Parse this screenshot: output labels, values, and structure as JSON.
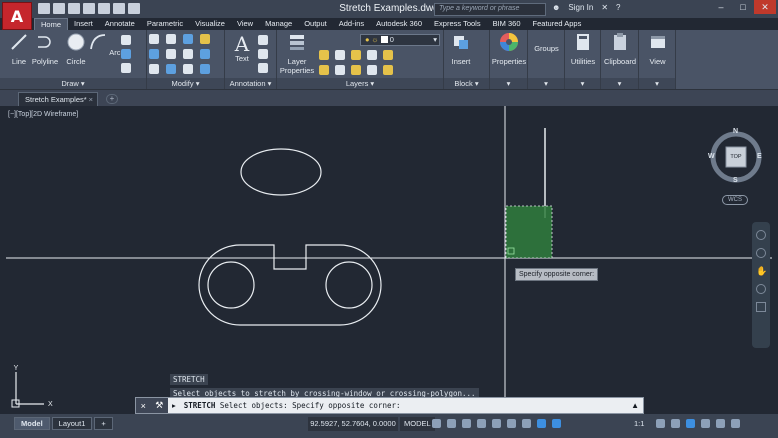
{
  "title_bar": {
    "app_logo": "A",
    "title": "Stretch Examples.dwg",
    "search_placeholder": "Type a keyword or phrase",
    "sign_in": "Sign In",
    "help": "?"
  },
  "ribbon": {
    "tabs": [
      "Home",
      "Insert",
      "Annotate",
      "Parametric",
      "Visualize",
      "View",
      "Manage",
      "Output",
      "Add-ins",
      "Autodesk 360",
      "Express Tools",
      "BIM 360",
      "Featured Apps"
    ],
    "active_tab": "Home",
    "draw": {
      "panel": "Draw",
      "tools": [
        "Line",
        "Polyline",
        "Circle",
        "Arc"
      ]
    },
    "modify": {
      "panel": "Modify"
    },
    "annotation": {
      "panel": "Annotation",
      "text_tool": "Text"
    },
    "layers": {
      "panel": "Layers",
      "layer_properties": "Layer Properties",
      "current_layer": "0"
    },
    "block": {
      "panel": "Block",
      "insert": "Insert"
    },
    "properties": {
      "label": "Properties"
    },
    "groups": {
      "label": "Groups"
    },
    "utilities": {
      "label": "Utilities"
    },
    "clipboard": {
      "label": "Clipboard"
    },
    "view": {
      "label": "View"
    }
  },
  "document_tabs": [
    {
      "label": "Stretch Examples*"
    }
  ],
  "viewport": {
    "label": "[−][Top][2D Wireframe]",
    "viewcube": {
      "face": "TOP",
      "north": "N",
      "south": "S",
      "east": "E",
      "west": "W"
    },
    "wcs": "WCS",
    "tooltip": "Specify opposite corner:"
  },
  "command": {
    "history": [
      "STRETCH",
      "Select objects to stretch by crossing-window or crossing-polygon..."
    ],
    "current_cmd": "STRETCH",
    "current_prompt": "Select objects: Specify opposite corner:"
  },
  "status_bar": {
    "layout_tabs": [
      "Model",
      "Layout1"
    ],
    "coordinates": "92.5927, 52.7604, 0.0000",
    "model_indicator": "MODEL",
    "scale": "1:1"
  },
  "colors": {
    "canvas": "#222833",
    "selection_window": "#2f7d3d",
    "accent": "#3d8fe0"
  }
}
